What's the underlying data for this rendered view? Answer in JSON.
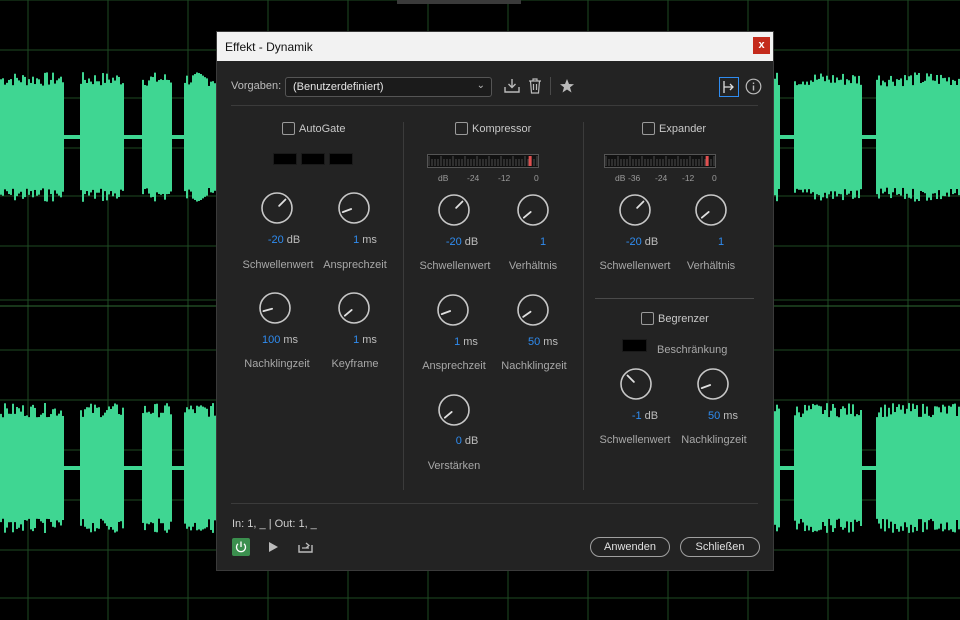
{
  "window": {
    "title": "Effekt - Dynamik",
    "close_glyph": "x"
  },
  "toolbar": {
    "presets_label": "Vorgaben:",
    "preset_value": "(Benutzerdefiniert)",
    "icons": [
      "save-preset-icon",
      "delete-preset-icon",
      "favorite-star-icon",
      "routing-icon",
      "info-icon"
    ]
  },
  "autogate": {
    "label": "AutoGate",
    "threshold": {
      "value": "-20",
      "unit": "dB",
      "caption": "Schwellenwert"
    },
    "attack": {
      "value": "1",
      "unit": "ms",
      "caption": "Ansprechzeit"
    },
    "release": {
      "value": "100",
      "unit": "ms",
      "caption": "Nachklingzeit"
    },
    "hold": {
      "value": "1",
      "unit": "ms",
      "caption": "Keyframe"
    }
  },
  "compressor": {
    "label": "Kompressor",
    "meter_labels": [
      "dB",
      "-24",
      "-12",
      "0"
    ],
    "threshold": {
      "value": "-20",
      "unit": "dB",
      "caption": "Schwellenwert"
    },
    "ratio": {
      "value": "1",
      "caption": "Verhältnis"
    },
    "attack": {
      "value": "1",
      "unit": "ms",
      "caption": "Ansprechzeit"
    },
    "release": {
      "value": "50",
      "unit": "ms",
      "caption": "Nachklingzeit"
    },
    "makeup": {
      "value": "0",
      "unit": "dB",
      "caption": "Verstärken"
    }
  },
  "expander": {
    "label": "Expander",
    "meter_labels": [
      "dB",
      "-36",
      "-24",
      "-12",
      "0"
    ],
    "threshold": {
      "value": "-20",
      "unit": "dB",
      "caption": "Schwellenwert"
    },
    "ratio": {
      "value": "1",
      "caption": "Verhältnis"
    }
  },
  "limiter": {
    "label": "Begrenzer",
    "restriction_label": "Beschränkung",
    "threshold": {
      "value": "-1",
      "unit": "dB",
      "caption": "Schwellenwert"
    },
    "release": {
      "value": "50",
      "unit": "ms",
      "caption": "Nachklingzeit"
    }
  },
  "footer": {
    "in_out": "In: 1, _ | Out: 1, _",
    "apply_label": "Anwenden",
    "close_label": "Schließen"
  },
  "colors": {
    "value_blue": "#2f8cf0",
    "waveform": "#3fd692",
    "power_green": "#3b8f4e",
    "meter_peak": "#e05050"
  }
}
